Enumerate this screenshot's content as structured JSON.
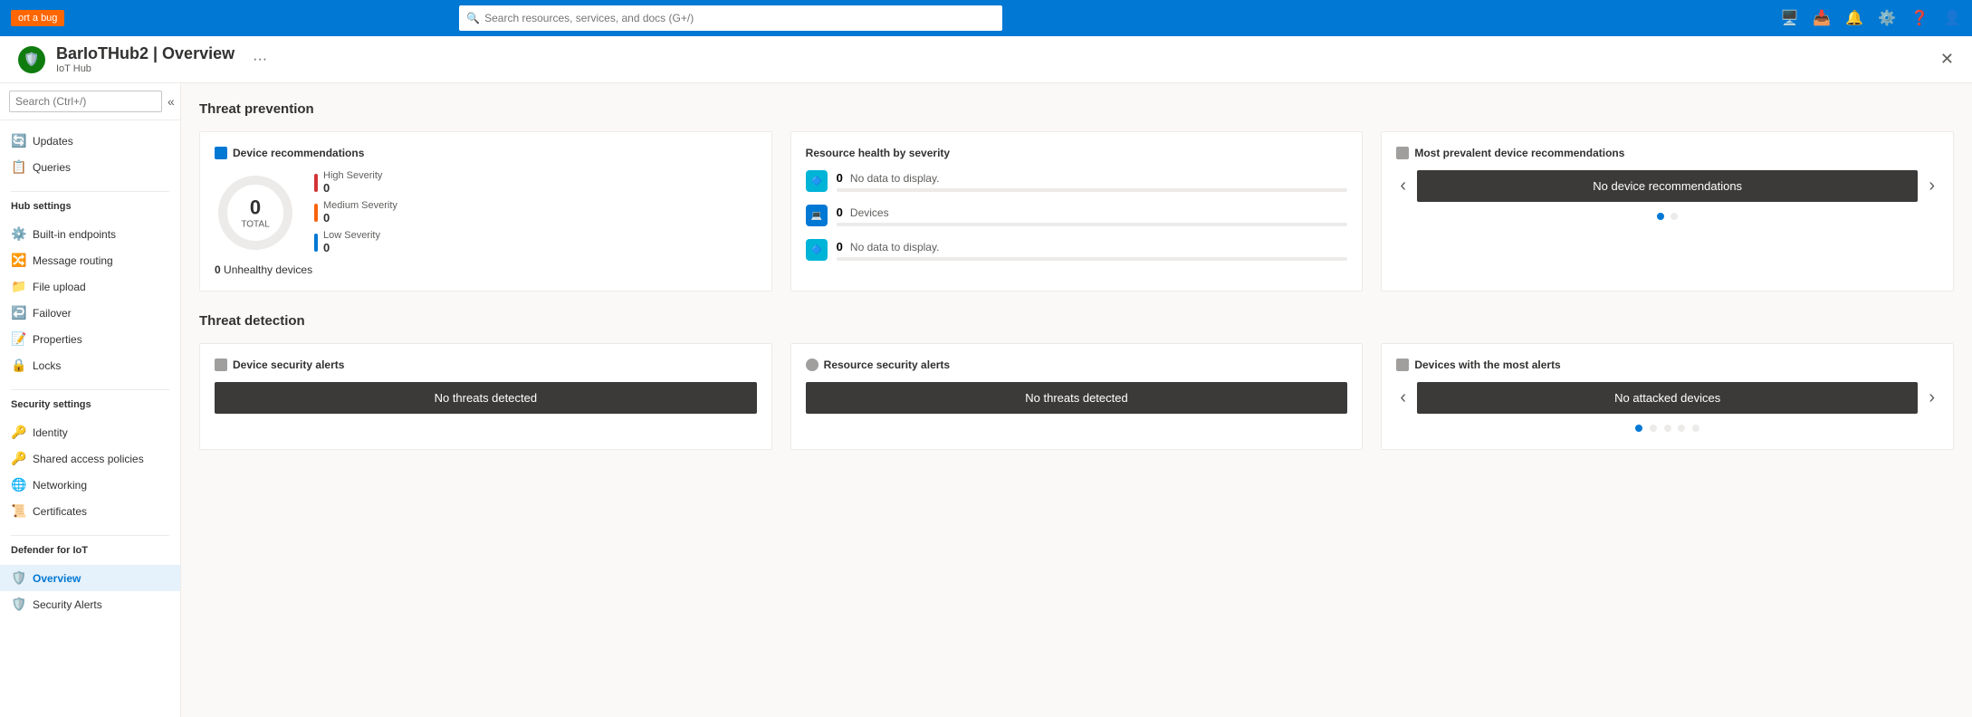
{
  "topBar": {
    "reportBug": "ort a bug",
    "searchPlaceholder": "Search resources, services, and docs (G+/)",
    "icons": [
      "📺",
      "📥",
      "🔔",
      "⚙️",
      "❓",
      "👤"
    ]
  },
  "header": {
    "title": "BarIoTHub2 | Overview",
    "subtitle": "IoT Hub",
    "moreLabel": "···",
    "closeLabel": "✕"
  },
  "sidebar": {
    "searchPlaceholder": "Search (Ctrl+/)",
    "sections": [
      {
        "group": "",
        "items": [
          {
            "id": "updates",
            "label": "Updates",
            "icon": "🔄"
          },
          {
            "id": "queries",
            "label": "Queries",
            "icon": "📋"
          }
        ]
      },
      {
        "group": "Hub settings",
        "items": [
          {
            "id": "built-in-endpoints",
            "label": "Built-in endpoints",
            "icon": "⚙️"
          },
          {
            "id": "message-routing",
            "label": "Message routing",
            "icon": "🔀"
          },
          {
            "id": "file-upload",
            "label": "File upload",
            "icon": "📁"
          },
          {
            "id": "failover",
            "label": "Failover",
            "icon": "↩️"
          },
          {
            "id": "properties",
            "label": "Properties",
            "icon": "📝"
          },
          {
            "id": "locks",
            "label": "Locks",
            "icon": "🔒"
          }
        ]
      },
      {
        "group": "Security settings",
        "items": [
          {
            "id": "identity",
            "label": "Identity",
            "icon": "🔑"
          },
          {
            "id": "shared-access-policies",
            "label": "Shared access policies",
            "icon": "🔑"
          },
          {
            "id": "networking",
            "label": "Networking",
            "icon": "🌐"
          },
          {
            "id": "certificates",
            "label": "Certificates",
            "icon": "📜"
          }
        ]
      },
      {
        "group": "Defender for IoT",
        "items": [
          {
            "id": "overview",
            "label": "Overview",
            "icon": "🛡️",
            "active": true
          },
          {
            "id": "security-alerts",
            "label": "Security Alerts",
            "icon": "🛡️"
          }
        ]
      }
    ]
  },
  "main": {
    "threatPrevention": {
      "title": "Threat prevention",
      "deviceRecommendations": {
        "label": "Device recommendations",
        "total": "0",
        "totalLabel": "TOTAL",
        "unhealthyDevices": "0 Unhealthy devices",
        "severities": [
          {
            "label": "High Severity",
            "count": "0",
            "level": "high"
          },
          {
            "label": "Medium Severity",
            "count": "0",
            "level": "medium"
          },
          {
            "label": "Low Severity",
            "count": "0",
            "level": "low"
          }
        ]
      },
      "resourceHealth": {
        "label": "Resource health by severity",
        "items": [
          {
            "count": "0",
            "name": "No data to display.",
            "type": "data"
          },
          {
            "count": "0",
            "name": "Devices",
            "type": "devices"
          },
          {
            "count": "0",
            "name": "No data to display.",
            "type": "data2"
          }
        ]
      },
      "mostPrevalent": {
        "label": "Most prevalent device recommendations",
        "buttonLabel": "No device recommendations",
        "dots": [
          true,
          false
        ]
      }
    },
    "threatDetection": {
      "title": "Threat detection",
      "deviceSecurityAlerts": {
        "label": "Device security alerts",
        "buttonLabel": "No threats detected"
      },
      "resourceSecurityAlerts": {
        "label": "Resource security alerts",
        "buttonLabel": "No threats detected"
      },
      "devicesWithMostAlerts": {
        "label": "Devices with the most alerts",
        "buttonLabel": "No attacked devices",
        "dots": [
          true,
          false,
          false,
          false,
          false
        ]
      }
    }
  }
}
